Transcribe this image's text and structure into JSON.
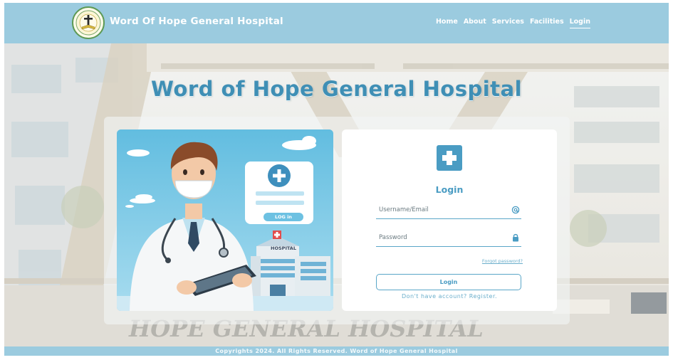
{
  "header": {
    "brand": "Word Of Hope General Hospital",
    "logo_icon": "hospital-seal-cross-book",
    "nav": [
      {
        "label": "Home",
        "active": false
      },
      {
        "label": "About",
        "active": false
      },
      {
        "label": "Services",
        "active": false
      },
      {
        "label": "Facilities",
        "active": false
      },
      {
        "label": "Login",
        "active": true
      }
    ]
  },
  "main": {
    "title": "Word of Hope General Hospital",
    "illustration": {
      "button_label": "LOG in",
      "building_label": "HOSPITAL",
      "background_sign_text": "HOPE GENERAL HOSPITAL"
    },
    "login": {
      "icon": "medical-cross-icon",
      "title": "Login",
      "username_placeholder": "Username/Email",
      "username_value": "",
      "username_icon": "at-sign-icon",
      "password_placeholder": "Password",
      "password_value": "",
      "password_icon": "lock-icon",
      "forgot": "Forgot password?",
      "button": "Login",
      "register": "Don't have account? Register."
    }
  },
  "footer": {
    "text": "Copyrights 2024. All Rights Reserved. Word of Hope General Hospital"
  },
  "colors": {
    "header_bg": "#9bcbdf",
    "accent": "#4a9cc3",
    "title": "#3f8fb5",
    "card_bg": "#ffffff"
  }
}
